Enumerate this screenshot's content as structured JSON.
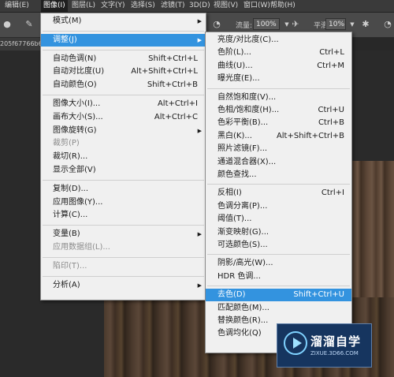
{
  "menubar": [
    {
      "label": "编辑(E)",
      "active": false
    },
    {
      "label": "图像(I)",
      "active": true
    },
    {
      "label": "图层(L)",
      "active": false
    },
    {
      "label": "文字(Y)",
      "active": false
    },
    {
      "label": "选择(S)",
      "active": false
    },
    {
      "label": "滤镜(T)",
      "active": false
    },
    {
      "label": "3D(D)",
      "active": false
    },
    {
      "label": "视图(V)",
      "active": false
    },
    {
      "label": "窗口(W)",
      "active": false
    },
    {
      "label": "帮助(H)",
      "active": false
    }
  ],
  "optbar": {
    "flow_label": "流量:",
    "flow_value": "100%",
    "smooth_label": "平滑:",
    "smooth_value": "10%"
  },
  "doc_tab": "205f67766b6",
  "image_menu": [
    {
      "label": "模式(M)",
      "shortcut": "",
      "submenu": true,
      "disabled": false,
      "highlighted": false
    },
    {
      "sep": true
    },
    {
      "label": "调整(J)",
      "shortcut": "",
      "submenu": true,
      "disabled": false,
      "highlighted": true
    },
    {
      "sep": true
    },
    {
      "label": "自动色调(N)",
      "shortcut": "Shift+Ctrl+L"
    },
    {
      "label": "自动对比度(U)",
      "shortcut": "Alt+Shift+Ctrl+L"
    },
    {
      "label": "自动颜色(O)",
      "shortcut": "Shift+Ctrl+B"
    },
    {
      "sep": true
    },
    {
      "label": "图像大小(I)...",
      "shortcut": "Alt+Ctrl+I"
    },
    {
      "label": "画布大小(S)...",
      "shortcut": "Alt+Ctrl+C"
    },
    {
      "label": "图像旋转(G)",
      "shortcut": "",
      "submenu": true
    },
    {
      "label": "裁剪(P)",
      "shortcut": "",
      "disabled": true
    },
    {
      "label": "裁切(R)...",
      "shortcut": ""
    },
    {
      "label": "显示全部(V)",
      "shortcut": ""
    },
    {
      "sep": true
    },
    {
      "label": "复制(D)...",
      "shortcut": ""
    },
    {
      "label": "应用图像(Y)...",
      "shortcut": ""
    },
    {
      "label": "计算(C)...",
      "shortcut": ""
    },
    {
      "sep": true
    },
    {
      "label": "变量(B)",
      "shortcut": "",
      "submenu": true
    },
    {
      "label": "应用数据组(L)...",
      "shortcut": "",
      "disabled": true
    },
    {
      "sep": true
    },
    {
      "label": "陷印(T)...",
      "shortcut": "",
      "disabled": true
    },
    {
      "sep": true
    },
    {
      "label": "分析(A)",
      "shortcut": "",
      "submenu": true
    }
  ],
  "adjust_menu": [
    {
      "label": "亮度/对比度(C)...",
      "shortcut": ""
    },
    {
      "label": "色阶(L)...",
      "shortcut": "Ctrl+L"
    },
    {
      "label": "曲线(U)...",
      "shortcut": "Ctrl+M"
    },
    {
      "label": "曝光度(E)...",
      "shortcut": ""
    },
    {
      "sep": true
    },
    {
      "label": "自然饱和度(V)...",
      "shortcut": ""
    },
    {
      "label": "色相/饱和度(H)...",
      "shortcut": "Ctrl+U"
    },
    {
      "label": "色彩平衡(B)...",
      "shortcut": "Ctrl+B"
    },
    {
      "label": "黑白(K)...",
      "shortcut": "Alt+Shift+Ctrl+B"
    },
    {
      "label": "照片滤镜(F)...",
      "shortcut": ""
    },
    {
      "label": "通道混合器(X)...",
      "shortcut": ""
    },
    {
      "label": "颜色查找...",
      "shortcut": ""
    },
    {
      "sep": true
    },
    {
      "label": "反相(I)",
      "shortcut": "Ctrl+I"
    },
    {
      "label": "色调分离(P)...",
      "shortcut": ""
    },
    {
      "label": "阈值(T)...",
      "shortcut": ""
    },
    {
      "label": "渐变映射(G)...",
      "shortcut": ""
    },
    {
      "label": "可选颜色(S)...",
      "shortcut": ""
    },
    {
      "sep": true
    },
    {
      "label": "阴影/高光(W)...",
      "shortcut": ""
    },
    {
      "label": "HDR 色调...",
      "shortcut": ""
    },
    {
      "sep": true
    },
    {
      "label": "去色(D)",
      "shortcut": "Shift+Ctrl+U",
      "highlighted": true
    },
    {
      "label": "匹配颜色(M)...",
      "shortcut": ""
    },
    {
      "label": "替换颜色(R)...",
      "shortcut": ""
    },
    {
      "label": "色调均化(Q)",
      "shortcut": ""
    }
  ],
  "watermark": {
    "brand": "溜溜自学",
    "url": "ZIXUE.3D66.COM"
  }
}
